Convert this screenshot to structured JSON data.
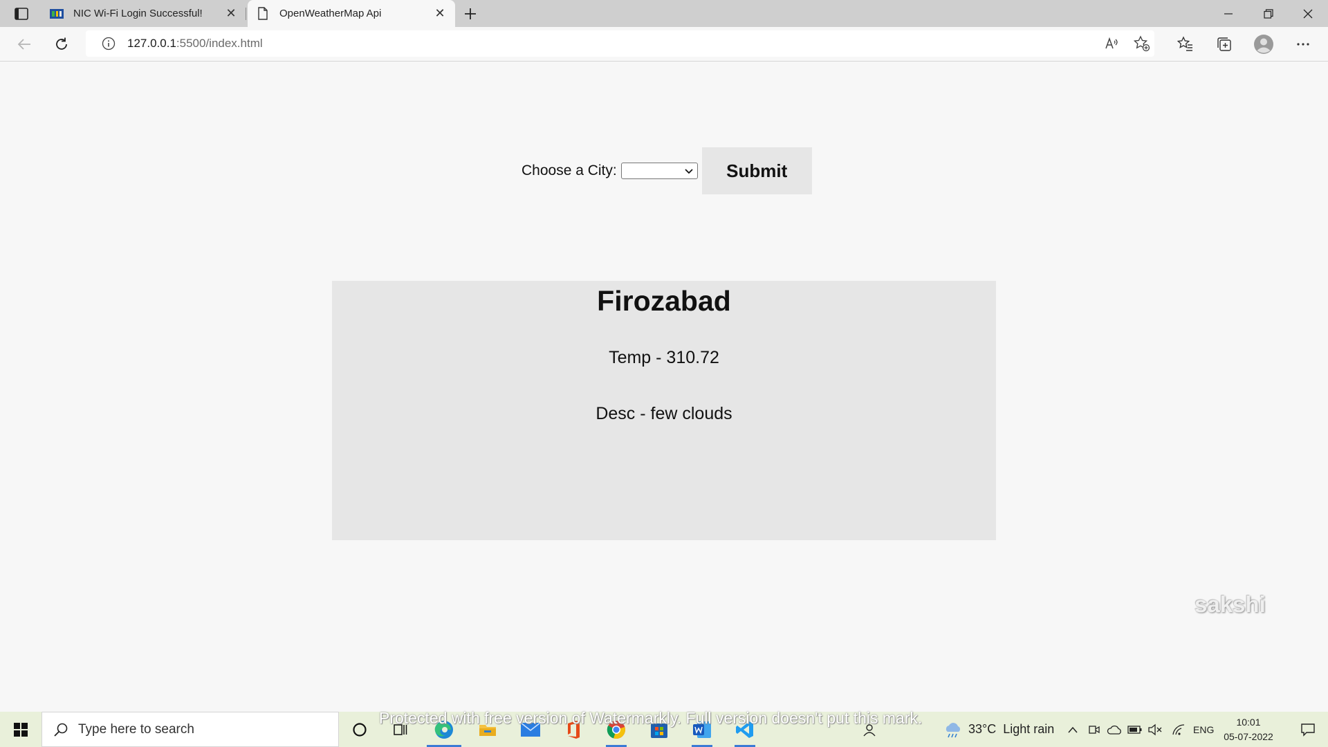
{
  "browser": {
    "tabs": [
      {
        "title": "NIC Wi-Fi Login Successful!",
        "active": false
      },
      {
        "title": "OpenWeatherMap Api",
        "active": true
      }
    ],
    "url_host": "127.0.0.1",
    "url_path": ":5500/index.html"
  },
  "page": {
    "city_label": "Choose a City:",
    "city_select_value": "",
    "submit_label": "Submit",
    "result": {
      "city": "Firozabad",
      "temp": "Temp - 310.72",
      "desc": "Desc - few clouds"
    },
    "user_mark": "sakshi"
  },
  "taskbar": {
    "search_placeholder": "Type here to search",
    "watermark": "Protected with free version of Watermarkly. Full version doesn't put this mark.",
    "weather_temp": "33°C",
    "weather_desc": "Light rain",
    "language": "ENG",
    "time": "10:01",
    "date": "05-07-2022"
  },
  "colors": {
    "page_bg": "#f7f7f7",
    "card_bg": "#e6e6e6",
    "tabstrip_bg": "#cfcfcf",
    "taskbar_bg": "#e9f0da",
    "accent": "#3a7bd5"
  }
}
